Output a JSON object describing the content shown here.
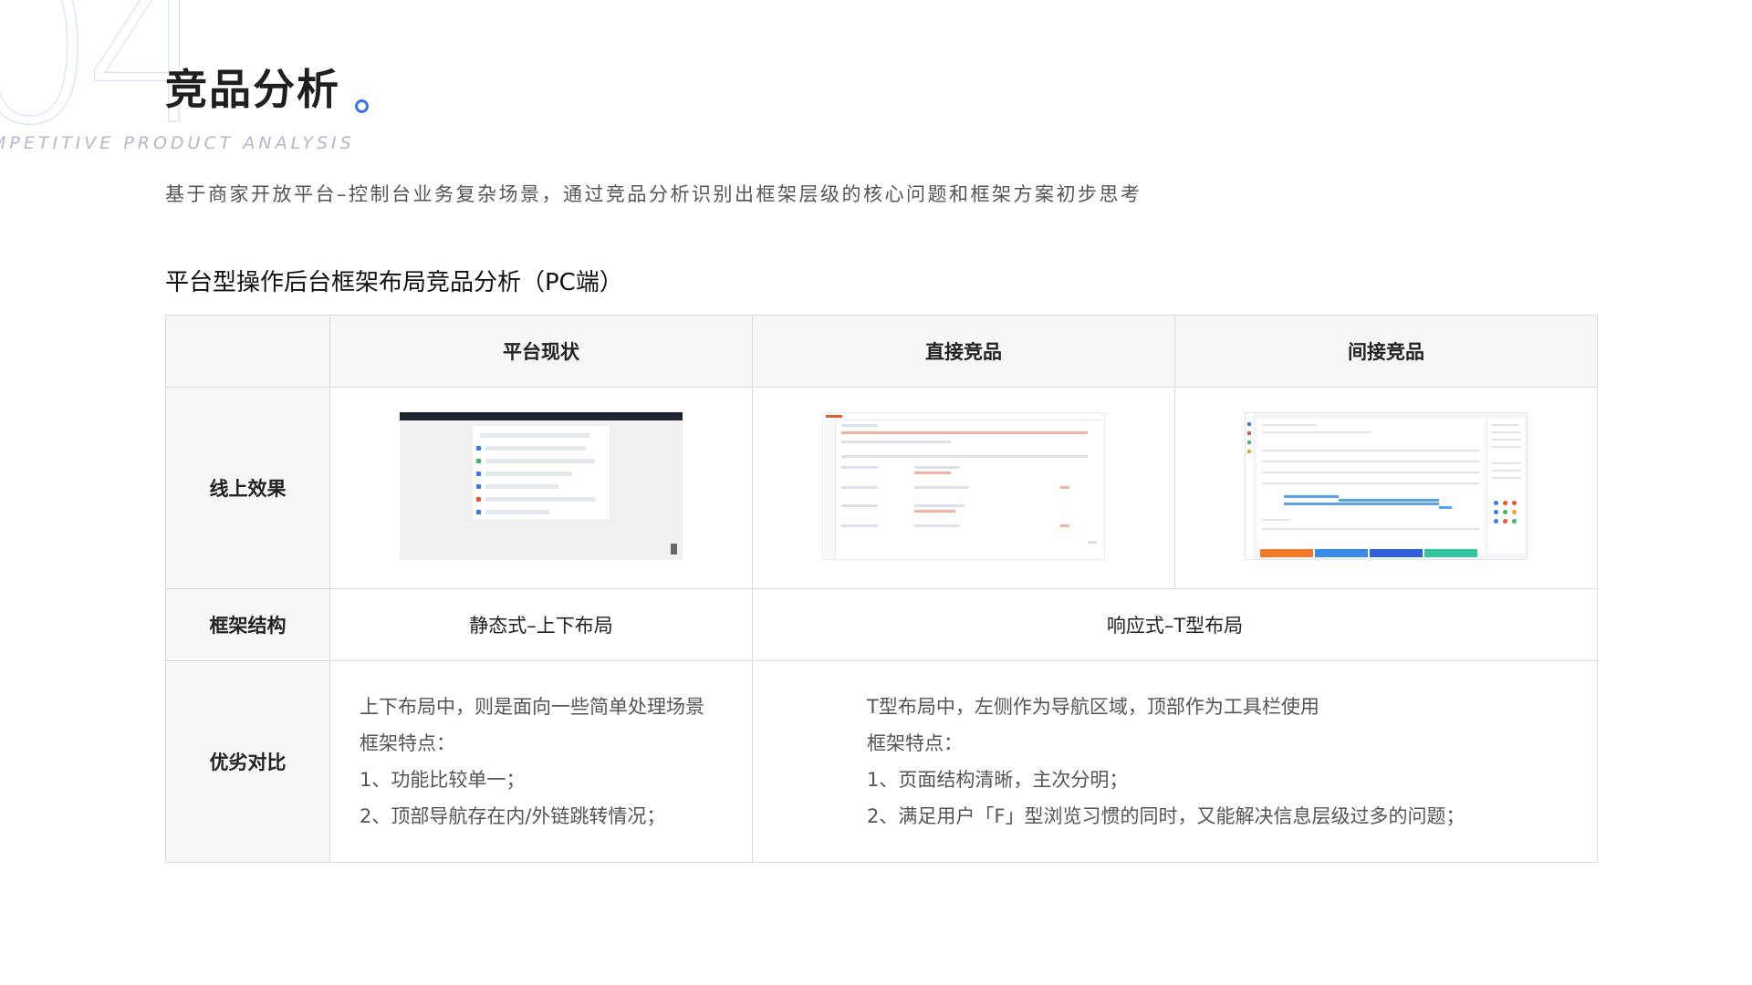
{
  "page": {
    "bg_number": "04",
    "title": "竞品分析",
    "subtitle_en": "MPETITIVE PRODUCT ANALYSIS",
    "intro": "基于商家开放平台–控制台业务复杂场景，通过竞品分析识别出框架层级的核心问题和框架方案初步思考",
    "section_title": "平台型操作后台框架布局竞品分析（PC端）",
    "accent_color": "#3b73e8"
  },
  "table": {
    "headers": [
      "",
      "平台现状",
      "直接竞品",
      "间接竞品"
    ],
    "rows": {
      "effect": {
        "label": "线上效果",
        "images": [
          "platform-screenshot",
          "direct-competitor-screenshot",
          "indirect-competitor-screenshot"
        ]
      },
      "frame": {
        "label": "框架结构",
        "platform": "静态式–上下布局",
        "competitors": "响应式–T型布局"
      },
      "pros": {
        "label": "优劣对比",
        "platform": [
          "上下布局中，则是面向一些简单处理场景",
          "框架特点：",
          "1、功能比较单一；",
          "2、顶部导航存在内/外链跳转情况；"
        ],
        "competitors": [
          "T型布局中，左侧作为导航区域，顶部作为工具栏使用",
          "框架特点：",
          "1、页面结构清晰，主次分明；",
          "2、满足用户「F」型浏览习惯的同时，又能解决信息层级过多的问题；"
        ]
      }
    }
  }
}
